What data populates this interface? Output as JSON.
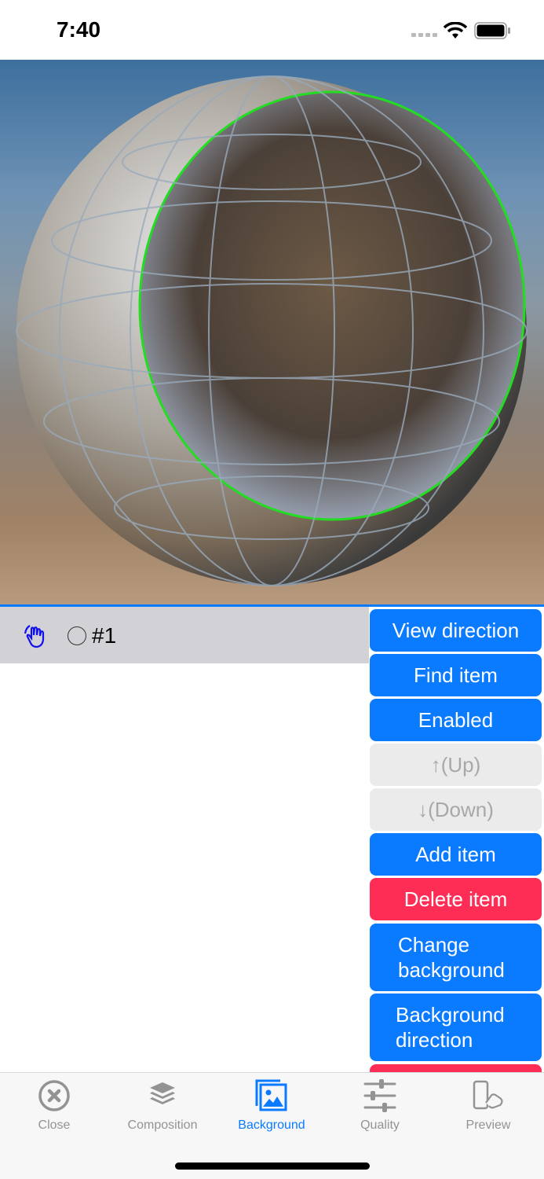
{
  "status_bar": {
    "time": "7:40"
  },
  "item_list": [
    {
      "label": "#1",
      "selected": false
    }
  ],
  "buttons": {
    "view_direction": "View direction",
    "find_item": "Find item",
    "enabled": "Enabled",
    "up": "↑(Up)",
    "down": "↓(Down)",
    "add_item": "Add item",
    "delete_item": "Delete item",
    "change_background_1": "Change",
    "change_background_2": "background",
    "background_direction_1": "Background",
    "background_direction_2": "direction"
  },
  "tabs": [
    {
      "label": "Close",
      "icon": "close-circle-icon"
    },
    {
      "label": "Composition",
      "icon": "layers-icon"
    },
    {
      "label": "Background",
      "icon": "photo-icon",
      "active": true
    },
    {
      "label": "Quality",
      "icon": "sliders-icon"
    },
    {
      "label": "Preview",
      "icon": "phone-touch-icon"
    }
  ],
  "colors": {
    "accent": "#0a7aff",
    "danger": "#fe2d55",
    "disabled": "#ebebeb"
  }
}
